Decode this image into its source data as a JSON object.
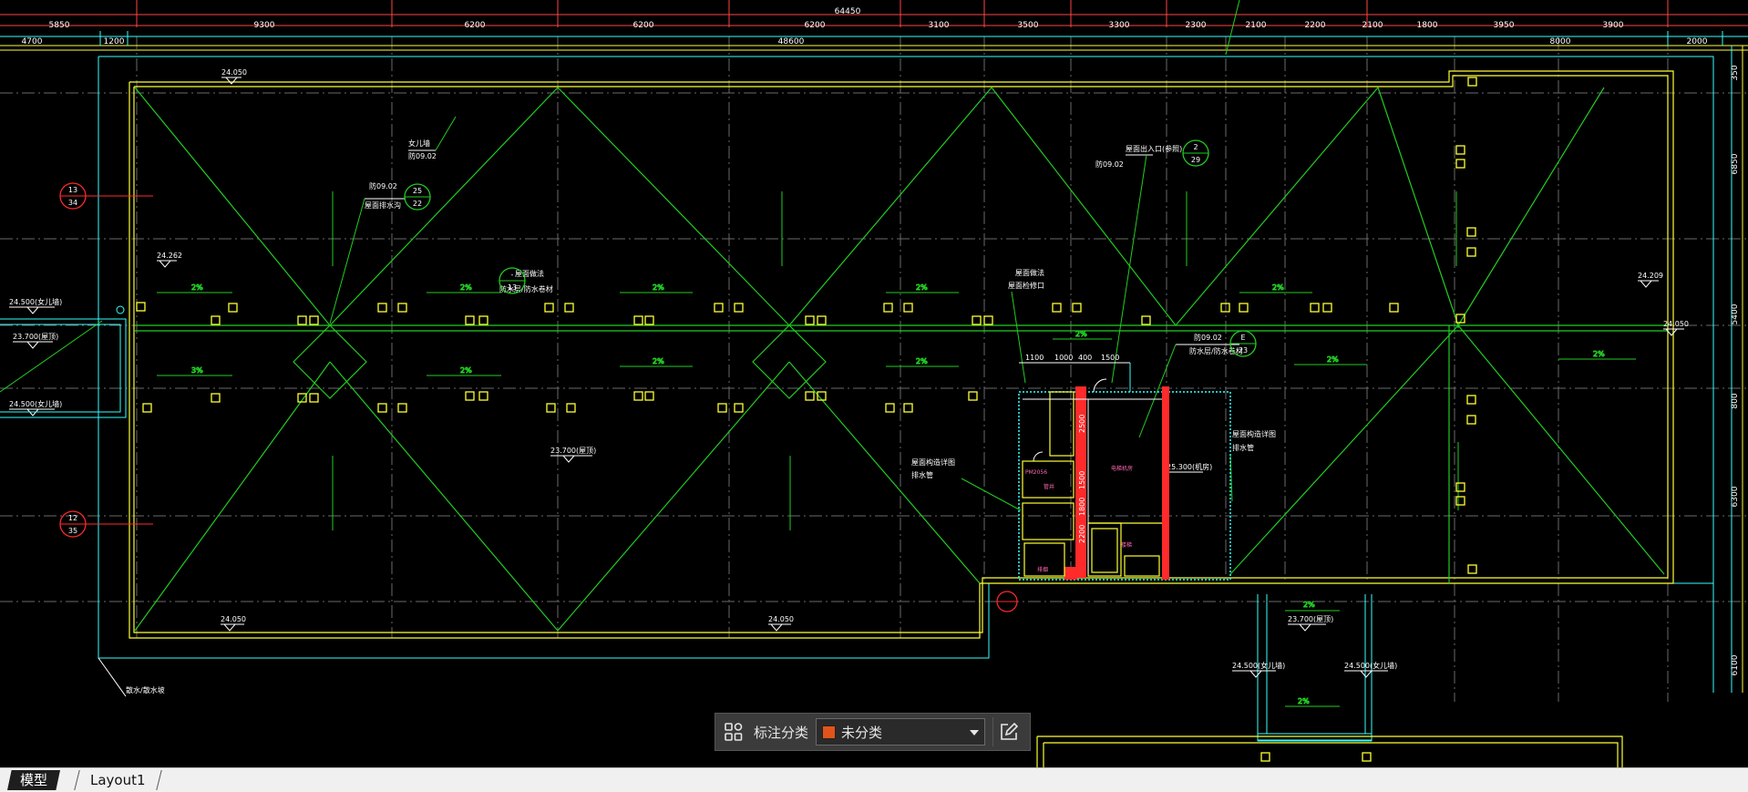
{
  "dims": {
    "top_total": "64450",
    "top": [
      "5850",
      "9300",
      "6200",
      "6200",
      "6200",
      "3100",
      "3500",
      "3300",
      "2300",
      "2100",
      "2200",
      "2100",
      "1800",
      "3950",
      "3900"
    ],
    "second": [
      "4700",
      "1200",
      "48600",
      "8000",
      "2000"
    ],
    "right": [
      "350",
      "6850",
      "5400",
      "800",
      "6300",
      "6100"
    ]
  },
  "elevations": [
    "24.050",
    "24.262",
    "24.500(女儿墙)",
    "23.700(屋顶)",
    "24.500(女儿墙)",
    "23.700(屋顶)",
    "24.050",
    "24.050",
    "24.209",
    "24.050",
    "23.700(屋顶)",
    "25.300(机房)",
    "23.700(屋顶)",
    "24.500(女儿墙)",
    "24.500(女儿墙)"
  ],
  "slopes": [
    "2%",
    "3%"
  ],
  "notes": [
    "防09.02",
    "屋面排水沟",
    "防09.02",
    "女儿墙",
    "屋面出入口(参照)",
    "防09.02",
    "防水层/防水卷材",
    "防09.02",
    "屋面检修口",
    "散水/散水坡",
    "屋面构造详图",
    "排水管",
    "屋面做法"
  ],
  "bubbles": [
    {
      "top": "13",
      "bottom": "34"
    },
    {
      "top": "12",
      "bottom": "35"
    },
    {
      "top": "25",
      "bottom": "22"
    },
    {
      "top": "2",
      "bottom": "29"
    },
    {
      "top": "-",
      "bottom": "13"
    },
    {
      "top": "E",
      "bottom": "23"
    }
  ],
  "core_dims": [
    "1100",
    "1000",
    "400",
    "1500",
    "2500",
    "1500",
    "1800",
    "2200"
  ],
  "core_labels": [
    "PM2056",
    "管井",
    "电梯机房",
    "楼梯",
    "排烟",
    "PM2056"
  ],
  "toolbar": {
    "label": "标注分类",
    "selected": "未分类",
    "selected_color": "#e0541c"
  },
  "tabs": [
    {
      "label": "模型",
      "active": true
    },
    {
      "label": "Layout1",
      "active": false
    }
  ],
  "colors": {
    "background": "#000000",
    "outline_yellow": "#ffff33",
    "cyan": "#33ffff",
    "green": "#22cc22",
    "axis_red": "#ff2a2a",
    "grid_gray": "#6f6f6f"
  }
}
